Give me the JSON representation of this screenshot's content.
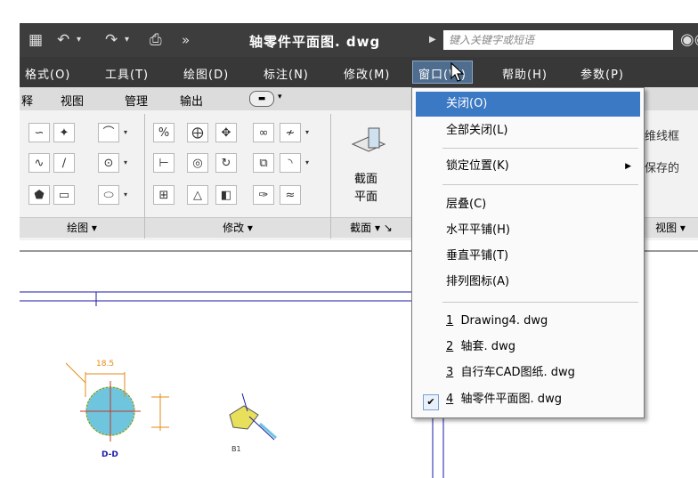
{
  "window": {
    "title": "轴零件平面图. dwg",
    "search_placeholder": "键入关键字或短语",
    "more_glyph": "»"
  },
  "menubar": {
    "items": [
      {
        "label": "格式(O)"
      },
      {
        "label": "工具(T)"
      },
      {
        "label": "绘图(D)"
      },
      {
        "label": "标注(N)"
      },
      {
        "label": "修改(M)"
      },
      {
        "label": "窗口(W)"
      },
      {
        "label": "帮助(H)"
      },
      {
        "label": "参数(P)"
      }
    ]
  },
  "ribbon": {
    "tabs": [
      {
        "label": "释"
      },
      {
        "label": "视图"
      },
      {
        "label": "管理"
      },
      {
        "label": "输出"
      }
    ],
    "panels": {
      "draw": "绘图 ▾",
      "modify": "修改 ▾",
      "section": "截面 ▾ ↘",
      "view": "视图 ▾"
    },
    "section_button": {
      "line1": "截面",
      "line2": "平面"
    },
    "right_labels": [
      "维线框",
      "保存的"
    ]
  },
  "drawing": {
    "label_dd": "D-D",
    "label_b1": "B1",
    "dim": "18.5"
  },
  "window_menu": {
    "items": [
      {
        "label": "关闭(O)"
      },
      {
        "label": "全部关闭(L)"
      },
      {
        "label": "锁定位置(K)"
      },
      {
        "label": "层叠(C)"
      },
      {
        "label": "水平平铺(H)"
      },
      {
        "label": "垂直平铺(T)"
      },
      {
        "label": "排列图标(A)"
      }
    ],
    "drawings": [
      {
        "num": "1",
        "label": "Drawing4. dwg"
      },
      {
        "num": "2",
        "label": "轴套. dwg"
      },
      {
        "num": "3",
        "label": "自行车CAD图纸. dwg"
      },
      {
        "num": "4",
        "label": "轴零件平面图. dwg"
      }
    ]
  },
  "colors": {
    "menu_highlight": "#3b79c4",
    "titlebar": "#3d3d3d",
    "menubar": "#383838",
    "cad_line": "#1a1aa8",
    "hatch": "#6fc5de",
    "dimension": "#e58a17"
  }
}
